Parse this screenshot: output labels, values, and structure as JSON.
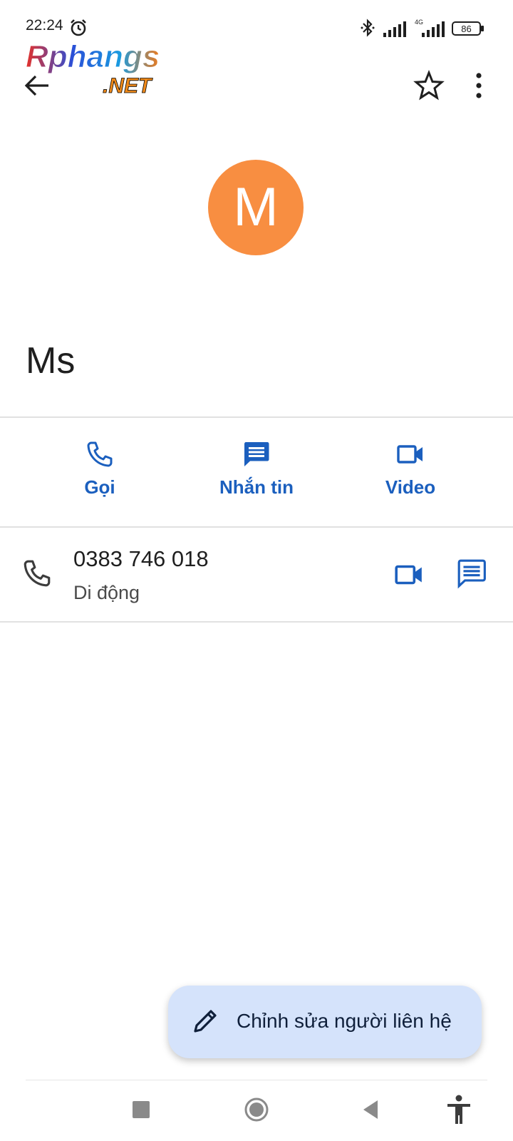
{
  "status_bar": {
    "time": "22:24",
    "signal2_label": "4G",
    "battery_level": "86"
  },
  "watermark": {
    "line1": "Rphangs",
    "line2": ".NET"
  },
  "toolbar": {
    "back_icon": "arrow-back-icon",
    "star_icon": "star-outline-icon",
    "more_icon": "more-vert-icon"
  },
  "contact": {
    "initial": "M",
    "name": "Ms",
    "avatar_color": "#f88e41"
  },
  "actions": [
    {
      "label": "Gọi",
      "icon": "phone-icon"
    },
    {
      "label": "Nhắn tin",
      "icon": "message-icon"
    },
    {
      "label": "Video",
      "icon": "video-icon"
    }
  ],
  "phone_entry": {
    "number": "0383 746 018",
    "type": "Di động"
  },
  "fab": {
    "label": "Chỉnh sửa người liên hệ",
    "icon": "edit-pencil-icon"
  },
  "colors": {
    "accent": "#1b5fbe",
    "fab_bg": "#d5e3fb"
  }
}
